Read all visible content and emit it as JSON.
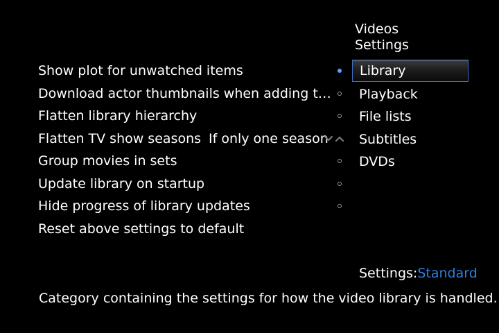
{
  "header": {
    "title_line1": "Videos",
    "title_line2": "Settings"
  },
  "settings": [
    {
      "label": "Show plot for unwatched items",
      "control": "radio",
      "checked": true
    },
    {
      "label": "Download actor thumbnails when adding to library",
      "control": "radio",
      "checked": false
    },
    {
      "label": "Flatten library hierarchy",
      "control": "radio",
      "checked": false
    },
    {
      "label": "Flatten TV show seasons",
      "control": "spinner",
      "value": "If only one season"
    },
    {
      "label": "Group movies in sets",
      "control": "radio",
      "checked": false
    },
    {
      "label": "Update library on startup",
      "control": "radio",
      "checked": false
    },
    {
      "label": "Hide progress of library updates",
      "control": "radio",
      "checked": false
    },
    {
      "label": "Reset above settings to default",
      "control": "button"
    }
  ],
  "categories": [
    {
      "label": "Library",
      "selected": true
    },
    {
      "label": "Playback",
      "selected": false
    },
    {
      "label": "File lists",
      "selected": false
    },
    {
      "label": "Subtitles",
      "selected": false
    },
    {
      "label": "DVDs",
      "selected": false
    }
  ],
  "settings_level": {
    "label": "Settings:",
    "value": "Standard"
  },
  "description": "Category containing the settings for how the video library is handled.",
  "icons": {
    "spinner_down": "chevron-down-icon",
    "spinner_up": "chevron-up-icon"
  },
  "colors": {
    "background": "#000000",
    "text": "#ffffff",
    "accent": "#2f7fe0",
    "radio_on": "#5aa3ff",
    "selection_border": "#3e6fc4"
  }
}
